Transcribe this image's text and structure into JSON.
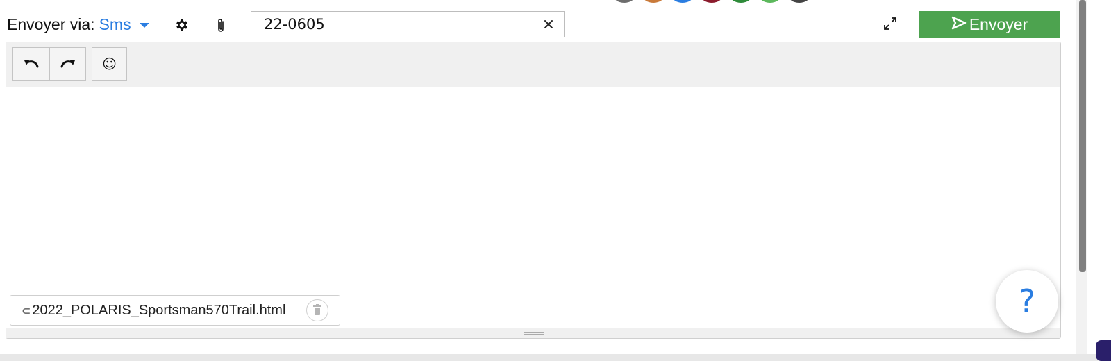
{
  "header": {
    "send_via_label": "Envoyer via:",
    "send_via_method": "Sms",
    "subject_value": "22-0605",
    "send_button_label": "Envoyer"
  },
  "icons": {
    "settings": "gear-icon",
    "attach": "paperclip-icon",
    "clear": "close-icon",
    "expand": "expand-icon",
    "send": "send-icon",
    "undo": "undo-icon",
    "redo": "redo-icon",
    "emoji": "emoji-icon",
    "trash": "trash-icon",
    "help": "help-icon"
  },
  "editor": {
    "emoji_glyph": "☺",
    "body_text": ""
  },
  "attachment": {
    "icon_glyph": "⊂",
    "file_name": "2022_POLARIS_Sportsman570Trail.html"
  },
  "help": {
    "label": "?"
  },
  "colors": {
    "accent": "#2a7de1",
    "send_button": "#4da34f",
    "toolbar_bg": "#f0f0f0"
  }
}
